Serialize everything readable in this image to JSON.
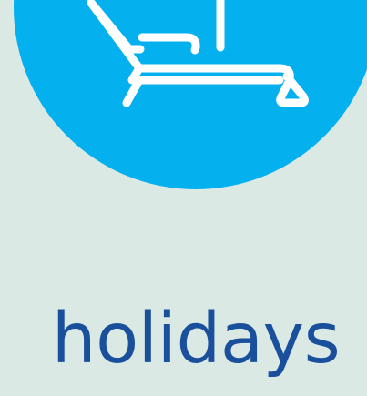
{
  "category": {
    "label": "holidays",
    "icon": "sun-lounger-icon",
    "colors": {
      "background": "#dbe9e5",
      "circle": "#05b0ef",
      "icon_stroke": "#ffffff",
      "label": "#1a4f9c"
    }
  }
}
